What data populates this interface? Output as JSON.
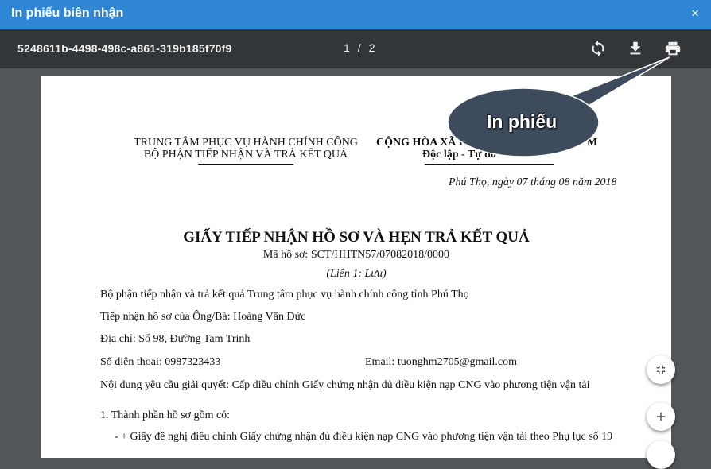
{
  "dialog": {
    "title": "In phiếu biên nhận",
    "close_icon": "×"
  },
  "toolbar": {
    "document_id": "5248611b-4498-498c-a861-319b185f70f9",
    "current_page": "1",
    "page_separator": "/",
    "total_pages": "2",
    "icons": [
      "rotate-icon",
      "download-icon",
      "print-icon"
    ]
  },
  "callout": {
    "text": "In phiếu",
    "color": "#3d4b5c"
  },
  "document": {
    "header_left_line1": "TRUNG TÂM PHỤC VỤ HÀNH CHÍNH CÔNG",
    "header_left_line2": "BỘ PHẬN TIẾP NHẬN VÀ TRẢ KẾT QUẢ",
    "header_right_line1": "CỘNG HÒA XÃ H",
    "header_right_line1_end": "M",
    "header_right_line2": "Độc lập - Tự do",
    "date_line": "Phú Thọ, ngày 07 tháng 08 năm 2018",
    "title": "GIẤY TIẾP NHẬN HỒ SƠ VÀ HẸN TRẢ KẾT QUẢ",
    "record_code": "Mã hồ sơ: SCT/HHTN57/07082018/0000",
    "copy_note": "(Liên 1: Lưu)",
    "line_department": "Bộ phận tiếp nhận và trả kết quả Trung tâm phục vụ hành chính công tỉnh Phú Thọ",
    "line_applicant": "Tiếp nhận hồ sơ của Ông/Bà: Hoàng Văn Đức",
    "line_address": "Địa chỉ: Số 98, Đường Tam Trinh",
    "line_phone": "Số điện thoại: 0987323433",
    "line_email": "Email: tuonghm2705@gmail.com",
    "line_request": "Nội dung yêu cầu giải quyết: Cấp điều chỉnh Giấy chứng nhận đủ điều kiện nạp CNG vào phương tiện vận tải",
    "section1_title": "1. Thành phần hồ sơ gồm có:",
    "section1_item1": "- + Giấy đề nghị điều chỉnh Giấy chứng nhận đủ điều kiện nạp CNG vào phương tiện vận tải theo Phụ lục số 19"
  },
  "zoom_controls": {
    "icons": [
      "fit-page-icon",
      "zoom-in-icon"
    ]
  },
  "theme": {
    "titlebar": "#2e86d4",
    "toolbar": "#323639",
    "viewer_bg": "#525659"
  }
}
